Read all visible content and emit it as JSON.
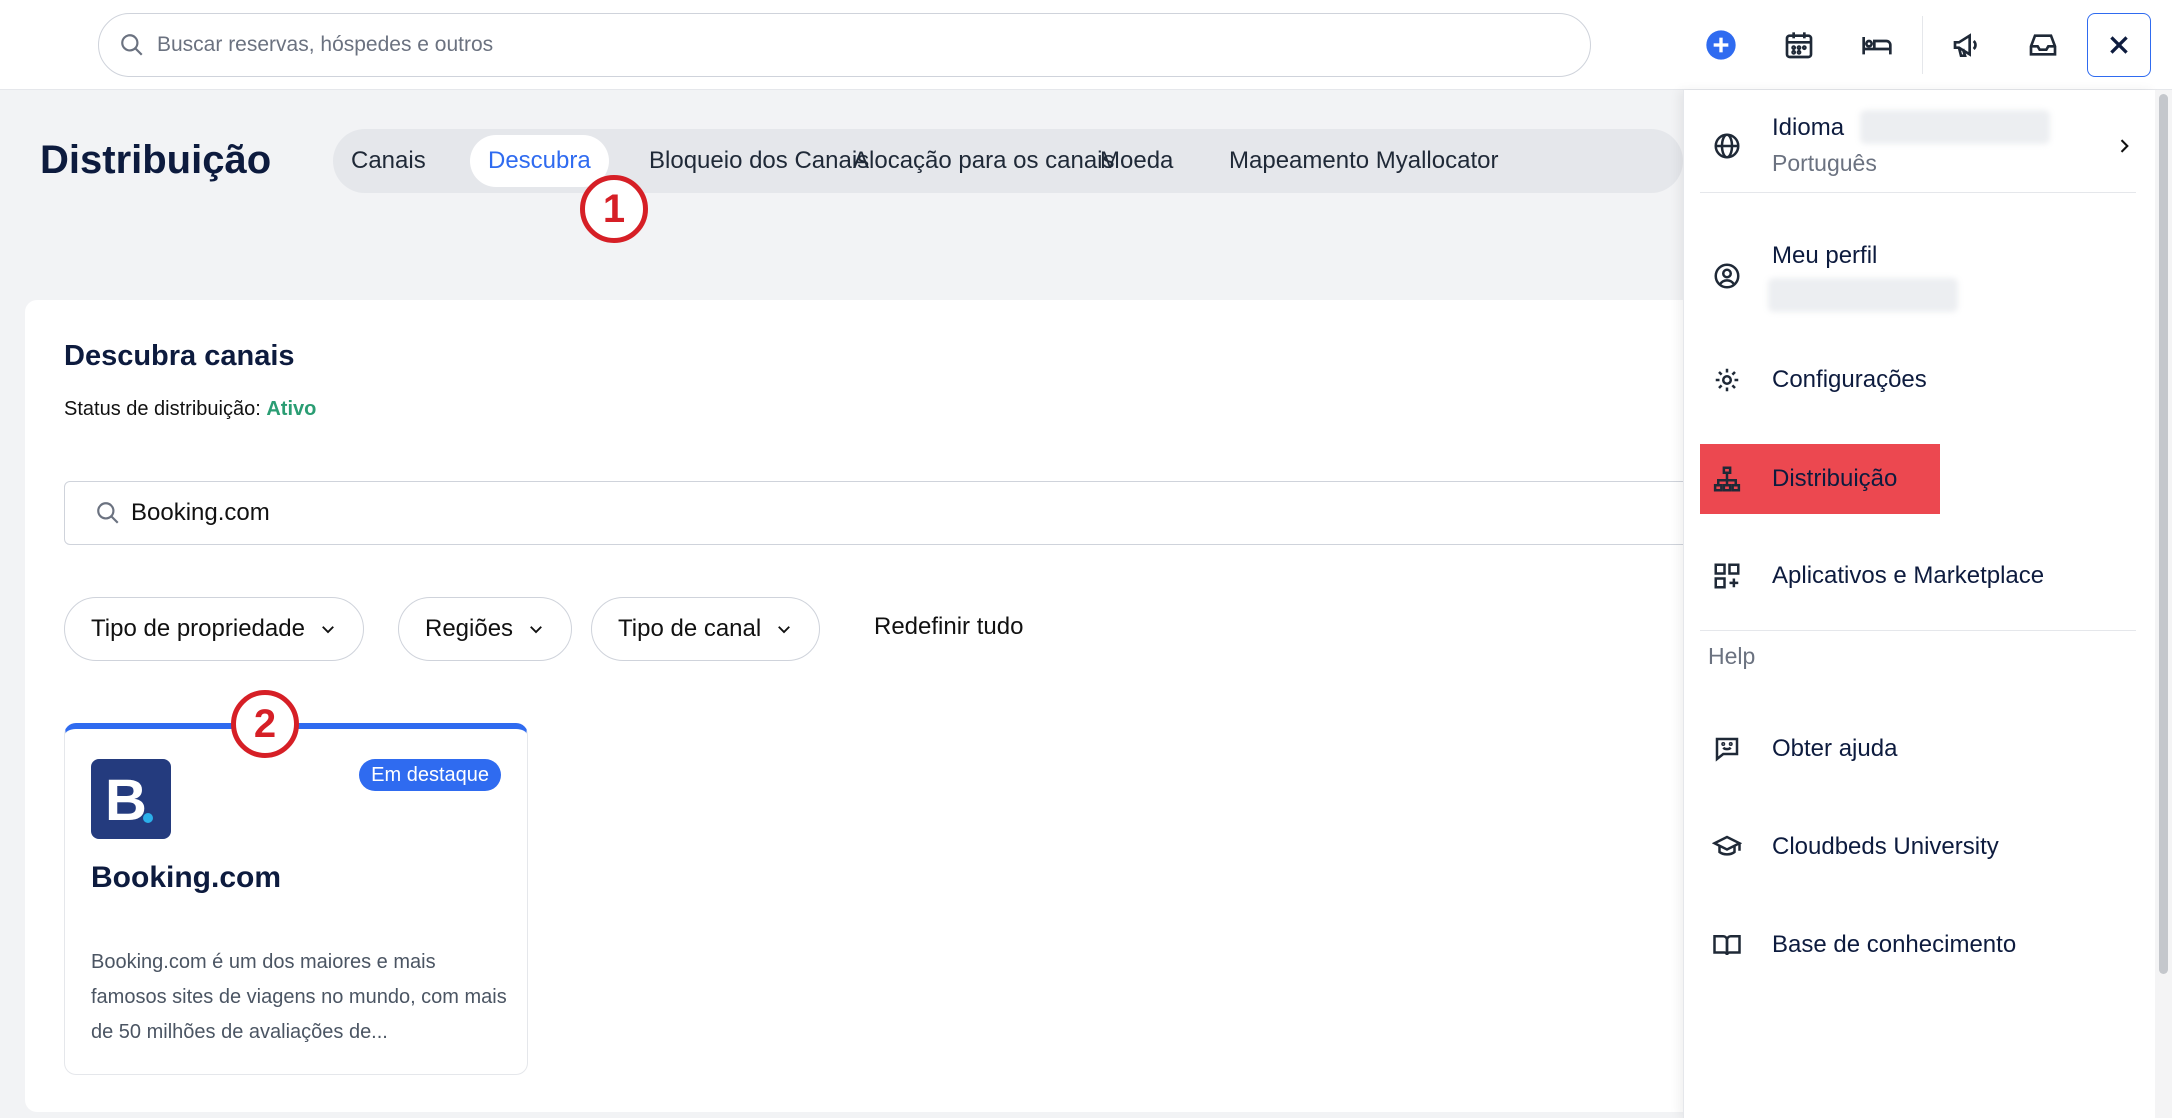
{
  "topbar": {
    "search_placeholder": "Buscar reservas, hóspedes e outros",
    "icons": [
      "add-icon",
      "calendar-icon",
      "bed-icon",
      "megaphone-icon",
      "inbox-icon",
      "close-icon"
    ]
  },
  "page": {
    "title": "Distribuição",
    "tabs": [
      "Canais",
      "Descubra",
      "Bloqueio dos Canais",
      "Alocação para os canais",
      "Moeda",
      "Mapeamento Myallocator"
    ],
    "active_tab": "Descubra"
  },
  "annotations": [
    "1",
    "2"
  ],
  "section": {
    "title": "Descubra canais",
    "status_label": "Status de distribuição:",
    "status_value": "Ativo",
    "search_value": "Booking.com",
    "filters": [
      "Tipo de propriedade",
      "Regiões",
      "Tipo de canal"
    ],
    "reset_label": "Redefinir tudo"
  },
  "card": {
    "logo_letter": "B",
    "badge": "Em destaque",
    "title": "Booking.com",
    "description": "Booking.com é um dos maiores e mais famosos sites de viagens no mundo, com mais de 50 milhões de avaliações de..."
  },
  "menu": {
    "language_label": "Idioma",
    "language_value": "Português",
    "profile_label": "Meu perfil",
    "settings_label": "Configurações",
    "distribution_label": "Distribuição",
    "apps_label": "Aplicativos e Marketplace",
    "help_heading": "Help",
    "get_help_label": "Obter ajuda",
    "university_label": "Cloudbeds University",
    "kb_label": "Base de conhecimento"
  },
  "colors": {
    "accent": "#2f6bf0",
    "active_menu": "#ec4850",
    "status_ok": "#2a9d73",
    "annotation": "#d61f26"
  }
}
